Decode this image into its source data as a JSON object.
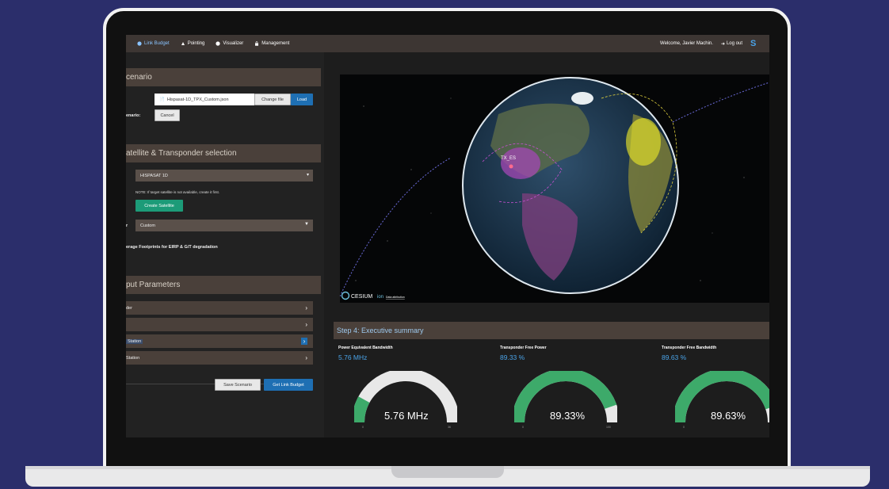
{
  "nav": {
    "items": [
      {
        "label": "Link Budget",
        "icon": "globe-icon"
      },
      {
        "label": "Pointing",
        "icon": "antenna-icon"
      },
      {
        "label": "Visualizer",
        "icon": "globe-icon"
      },
      {
        "label": "Management",
        "icon": "lock-icon"
      }
    ],
    "welcome": "Welcome, Javier Machin.",
    "logout": "Log out"
  },
  "scenario": {
    "title": "cenario",
    "label": "enario:",
    "file": "Hispasat-1D_TPX_Custom.json",
    "change_file": "Change file",
    "load": "Load",
    "cancel": "Cancel"
  },
  "satellite": {
    "title": "atellite & Transponder selection",
    "selected": "HISPASAT 1D",
    "note": "NOTE: If target satellite is not available, create it first.",
    "create": "Create Satellite",
    "transponder_label": "r",
    "transponder": "Custom",
    "footprints": "erage Footprints for EIRP & G/T degradation"
  },
  "input": {
    "title": "put Parameters",
    "params": [
      "der",
      "",
      "Station",
      "Station"
    ]
  },
  "actions": {
    "save": "Save Scenario",
    "get": "Get Link Budget"
  },
  "globe": {
    "station_label": "TX_ES",
    "cesium": "CESIUM",
    "ion": "ion",
    "attribution": "Data attribution"
  },
  "summary": {
    "title": "Step 4: Executive summary",
    "kpis": [
      {
        "label": "Power Equivalent Bandwidth",
        "value": "5.76 MHz",
        "gauge": "5.76 MHz",
        "min": "0",
        "max": "36",
        "fraction": 0.16
      },
      {
        "label": "Transponder Free Power",
        "value": "89.33 %",
        "gauge": "89.33%",
        "min": "0",
        "max": "100",
        "fraction": 0.8933
      },
      {
        "label": "Transponder Free Bandwidth",
        "value": "89.63 %",
        "gauge": "89.63%",
        "min": "0",
        "max": "100",
        "fraction": 0.8963
      }
    ]
  },
  "colors": {
    "accent_blue": "#1e6fb3",
    "green": "#1c9b78",
    "gauge_green": "#3daa6a",
    "panel_header": "#4a403a",
    "background": "#2b2e6b"
  }
}
